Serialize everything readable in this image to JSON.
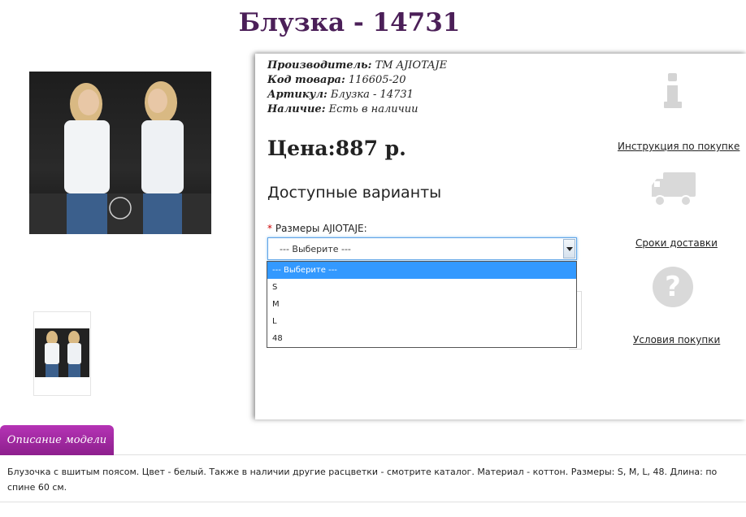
{
  "product": {
    "title": "Блузка - 14731",
    "manufacturer_label": "Производитель:",
    "manufacturer_value": "ТМ AJIOTAJE",
    "code_label": "Код товара:",
    "code_value": "116605-20",
    "article_label": "Артикул:",
    "article_value": "Блузка - 14731",
    "availability_label": "Наличие:",
    "availability_value": "Есть в наличии",
    "price": "Цена:887 р."
  },
  "options": {
    "heading": "Доступные варианты",
    "required_mark": "*",
    "size_label": "Размеры AJIOTAJE:",
    "select_value": "--- Выберите ---",
    "dropdown_items": [
      "--- Выберите ---",
      "S",
      "M",
      "L",
      "48"
    ],
    "selected_index": 0
  },
  "side_links": {
    "instructions": "Инструкция по покупке",
    "delivery": "Сроки доставки",
    "conditions": "Условия покупки"
  },
  "icons": {
    "info": "info-icon",
    "truck": "truck-icon",
    "question": "question-icon"
  },
  "tabs": {
    "description_tab": "Описание модели"
  },
  "description": {
    "text": "Блузочка с вшитым поясом. Цвет - белый. Также в наличии другие расцветки - смотрите каталог. Материал - коттон. Размеры: S, M, L, 48. Длина: по спине 60 см."
  },
  "colors": {
    "title": "#4b1f58",
    "tab": "#a52ba5",
    "select_highlight": "#3399ff",
    "icon_gray": "#d9d9d9"
  }
}
